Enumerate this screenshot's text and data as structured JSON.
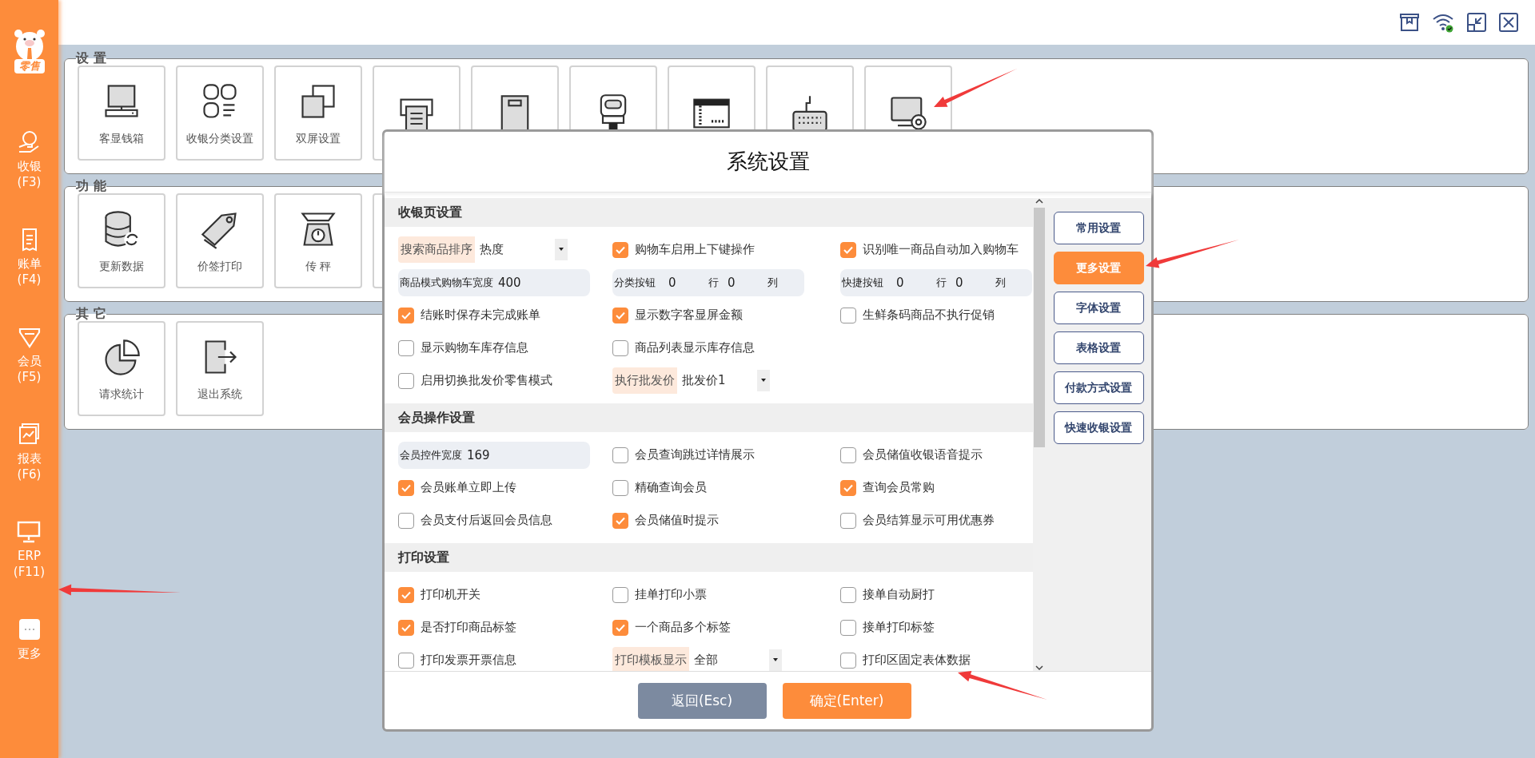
{
  "sidebar": {
    "logo_text": "零售",
    "items": [
      {
        "label": "收银",
        "key": "(F3)"
      },
      {
        "label": "账单",
        "key": "(F4)"
      },
      {
        "label": "会员",
        "key": "(F5)"
      },
      {
        "label": "报表",
        "key": "(F6)"
      },
      {
        "label": "ERP",
        "key": "(F11)"
      },
      {
        "label": "更多"
      }
    ]
  },
  "panels": [
    {
      "title": "设 置",
      "tiles": [
        {
          "label": "客显钱箱"
        },
        {
          "label": "收银分类设置"
        },
        {
          "label": "双屏设置"
        }
      ]
    },
    {
      "title": "功 能",
      "tiles": [
        {
          "label": "更新数据"
        },
        {
          "label": "价签打印"
        },
        {
          "label": "传 秤"
        }
      ]
    },
    {
      "title": "其 它",
      "tiles": [
        {
          "label": "请求统计"
        },
        {
          "label": "退出系统"
        }
      ]
    }
  ],
  "dialog": {
    "title": "系统设置",
    "sections": [
      {
        "title": "收银页设置",
        "rows": [
          [
            {
              "kind": "select",
              "label": "搜索商品排序",
              "value": "热度"
            },
            {
              "kind": "checkbox",
              "label": "购物车启用上下键操作",
              "checked": true
            },
            {
              "kind": "checkbox",
              "label": "识别唯一商品自动加入购物车",
              "checked": true
            }
          ],
          [
            {
              "kind": "number",
              "label": "商品模式购物车宽度",
              "value": "400"
            },
            {
              "kind": "grid",
              "label": "分类按钮",
              "rows_value": "0",
              "rows_unit": "行",
              "cols_value": "0",
              "cols_unit": "列"
            },
            {
              "kind": "grid",
              "label": "快捷按钮",
              "rows_value": "0",
              "rows_unit": "行",
              "cols_value": "0",
              "cols_unit": "列"
            }
          ],
          [
            {
              "kind": "checkbox",
              "label": "结账时保存未完成账单",
              "checked": true
            },
            {
              "kind": "checkbox",
              "label": "显示数字客显屏金额",
              "checked": true
            },
            {
              "kind": "checkbox",
              "label": "生鲜条码商品不执行促销",
              "checked": false
            }
          ],
          [
            {
              "kind": "checkbox",
              "label": "显示购物车库存信息",
              "checked": false
            },
            {
              "kind": "checkbox",
              "label": "商品列表显示库存信息",
              "checked": false
            }
          ],
          [
            {
              "kind": "checkbox",
              "label": "启用切换批发价零售模式",
              "checked": false
            },
            {
              "kind": "select",
              "label": "执行批发价",
              "value": "批发价1"
            }
          ]
        ]
      },
      {
        "title": "会员操作设置",
        "rows": [
          [
            {
              "kind": "number",
              "label": "会员控件宽度",
              "value": "169"
            },
            {
              "kind": "checkbox",
              "label": "会员查询跳过详情展示",
              "checked": false
            },
            {
              "kind": "checkbox",
              "label": "会员储值收银语音提示",
              "checked": false
            }
          ],
          [
            {
              "kind": "checkbox",
              "label": "会员账单立即上传",
              "checked": true
            },
            {
              "kind": "checkbox",
              "label": "精确查询会员",
              "checked": false
            },
            {
              "kind": "checkbox",
              "label": "查询会员常购",
              "checked": true
            }
          ],
          [
            {
              "kind": "checkbox",
              "label": "会员支付后返回会员信息",
              "checked": false
            },
            {
              "kind": "checkbox",
              "label": "会员储值时提示",
              "checked": true
            },
            {
              "kind": "checkbox",
              "label": "会员结算显示可用优惠券",
              "checked": false
            }
          ]
        ]
      },
      {
        "title": "打印设置",
        "rows": [
          [
            {
              "kind": "checkbox",
              "label": "打印机开关",
              "checked": true
            },
            {
              "kind": "checkbox",
              "label": "挂单打印小票",
              "checked": false
            },
            {
              "kind": "checkbox",
              "label": "接单自动厨打",
              "checked": false
            }
          ],
          [
            {
              "kind": "checkbox",
              "label": "是否打印商品标签",
              "checked": true
            },
            {
              "kind": "checkbox",
              "label": "一个商品多个标签",
              "checked": true
            },
            {
              "kind": "checkbox",
              "label": "接单打印标签",
              "checked": false
            }
          ],
          [
            {
              "kind": "checkbox",
              "label": "打印发票开票信息",
              "checked": false
            },
            {
              "kind": "select",
              "label": "打印模板显示",
              "value": "全部"
            },
            {
              "kind": "checkbox",
              "label": "打印区固定表体数据",
              "checked": false
            }
          ]
        ]
      }
    ],
    "nav": [
      {
        "label": "常用设置",
        "selected": false
      },
      {
        "label": "更多设置",
        "selected": true
      },
      {
        "label": "字体设置",
        "selected": false
      },
      {
        "label": "表格设置",
        "selected": false
      },
      {
        "label": "付款方式设置",
        "selected": false
      },
      {
        "label": "快速收银设置",
        "selected": false
      }
    ],
    "buttons": [
      {
        "label": "返回(Esc)",
        "kind": "secondary"
      },
      {
        "label": "确定(Enter)",
        "kind": "primary"
      }
    ]
  }
}
